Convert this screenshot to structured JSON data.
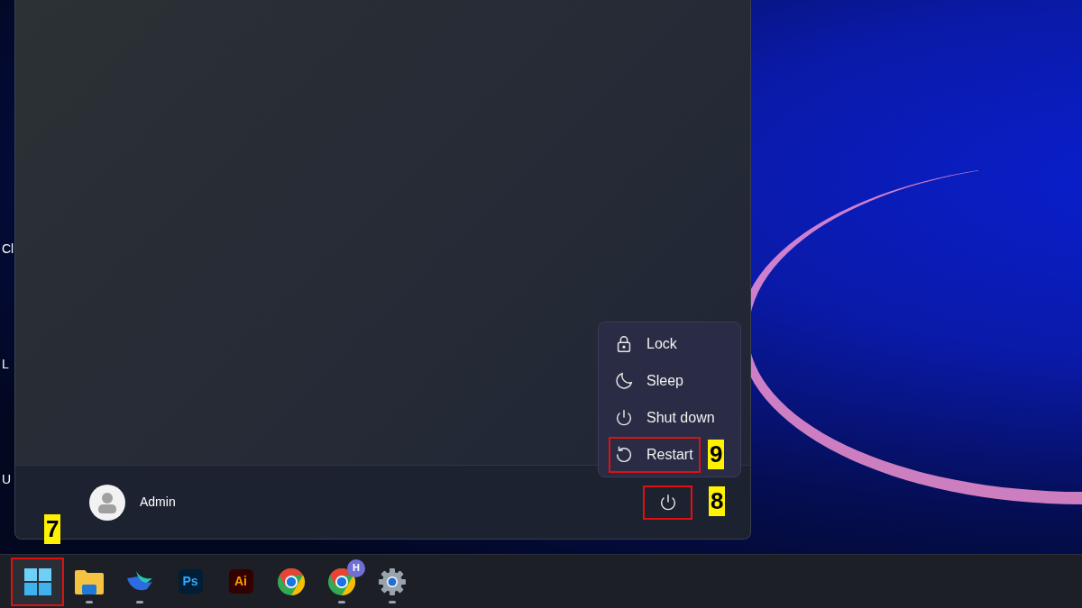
{
  "desktop_labels": [
    "Cl",
    "L",
    "U"
  ],
  "start_menu": {
    "user": {
      "name": "Admin"
    },
    "power_button": {
      "annotation": "8"
    },
    "power_menu": [
      {
        "kind": "lock",
        "label": "Lock"
      },
      {
        "kind": "sleep",
        "label": "Sleep"
      },
      {
        "kind": "shutdown",
        "label": "Shut down"
      },
      {
        "kind": "restart",
        "label": "Restart",
        "annotation": "9"
      }
    ]
  },
  "taskbar": [
    {
      "kind": "start",
      "running": false,
      "annotation": "7"
    },
    {
      "kind": "folder",
      "running": true
    },
    {
      "kind": "bird",
      "running": true
    },
    {
      "kind": "ps",
      "text": "Ps",
      "running": false
    },
    {
      "kind": "ai",
      "text": "Ai",
      "running": false
    },
    {
      "kind": "chrome",
      "running": false
    },
    {
      "kind": "chrome",
      "badge": "H",
      "running": true
    },
    {
      "kind": "settings",
      "running": true
    }
  ]
}
